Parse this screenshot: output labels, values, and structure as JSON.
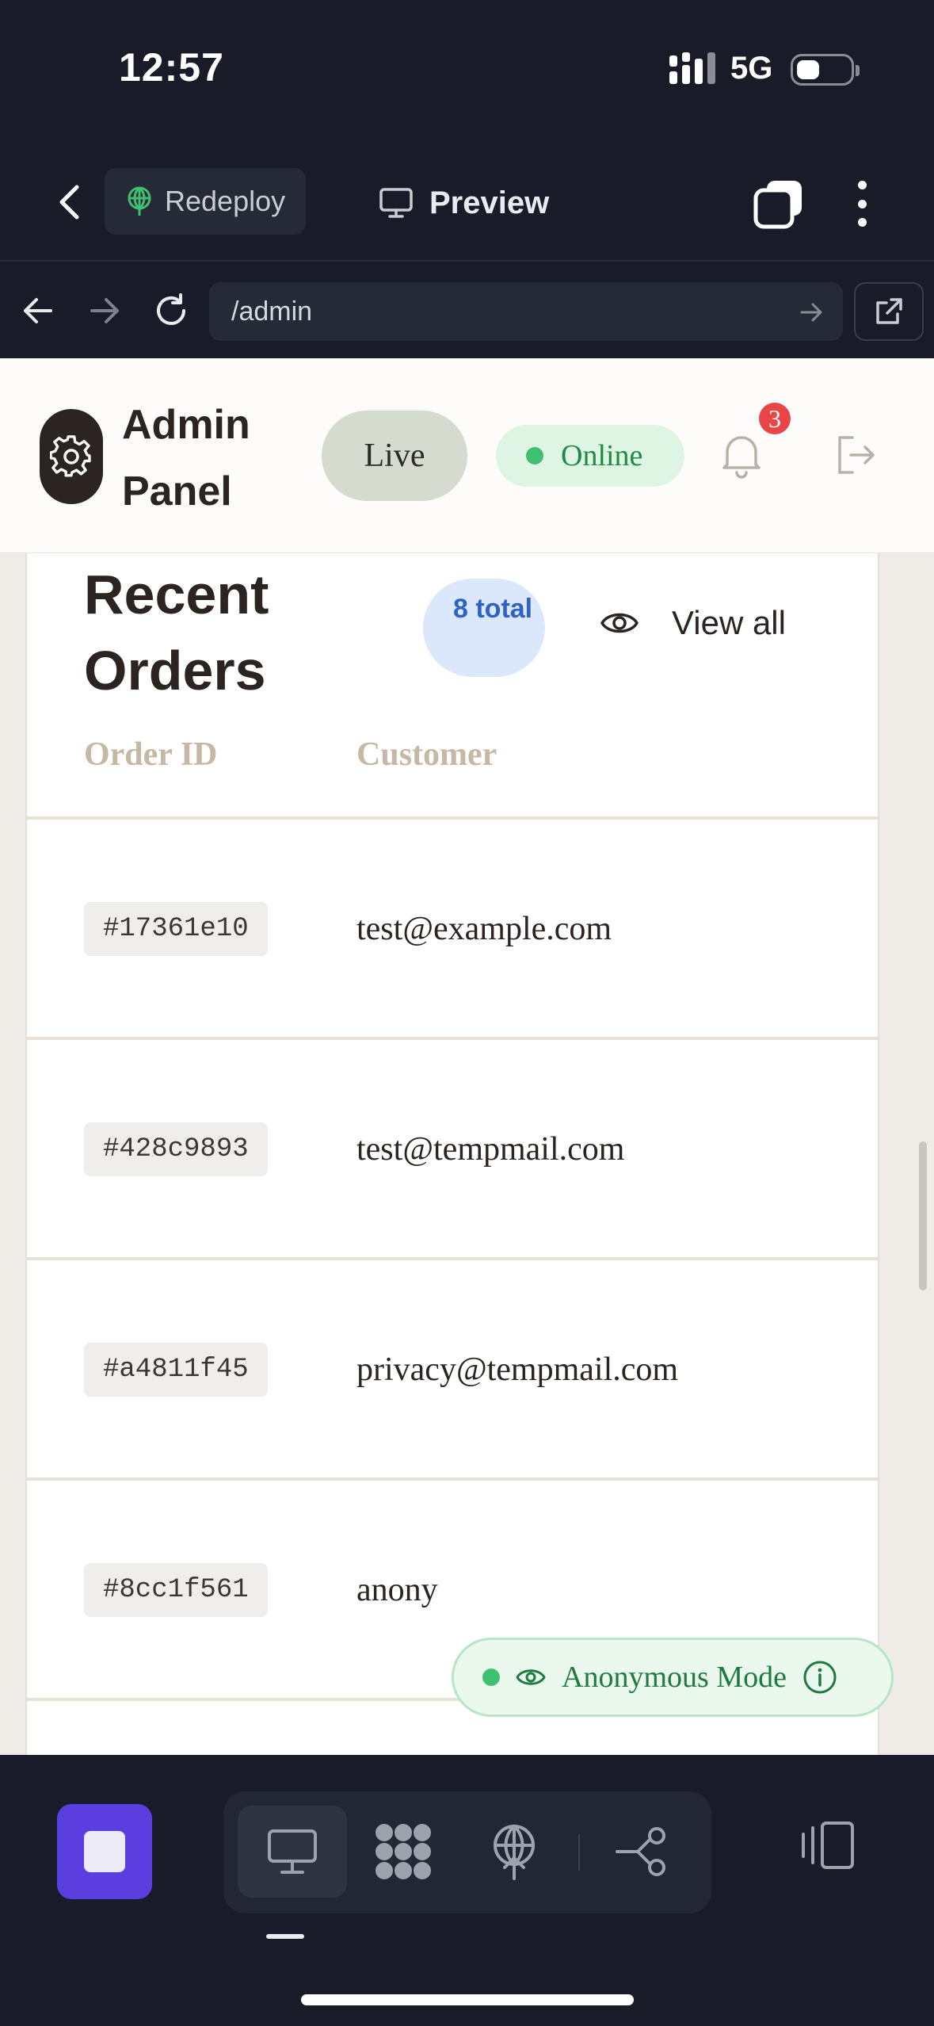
{
  "status_bar": {
    "time": "12:57",
    "network": "5G"
  },
  "toolbar": {
    "redeploy_label": "Redeploy",
    "preview_label": "Preview"
  },
  "browser": {
    "url": "/admin"
  },
  "admin": {
    "brand": "Admin Panel",
    "live_label": "Live",
    "online_label": "Online",
    "notification_count": "3"
  },
  "orders": {
    "title": "Recent Orders",
    "total_label": "8 total",
    "view_all_label": "View all",
    "columns": [
      "Order ID",
      "Customer"
    ],
    "rows": [
      {
        "id": "#17361e10",
        "customer": "test@example.com"
      },
      {
        "id": "#428c9893",
        "customer": "test@tempmail.com"
      },
      {
        "id": "#a4811f45",
        "customer": "privacy@tempmail.com"
      },
      {
        "id": "#8cc1f561",
        "customer": "anony"
      }
    ]
  },
  "anonymous_mode": {
    "label": "Anonymous Mode"
  },
  "colors": {
    "accent": "#5a3ee0",
    "online": "#1f8a47",
    "badge": "#e94545",
    "total_pill": "#2f62c6"
  }
}
